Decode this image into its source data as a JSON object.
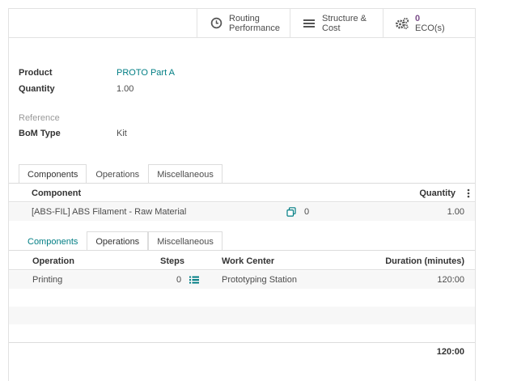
{
  "smart_buttons": {
    "routing": {
      "line1": "Routing",
      "line2": "Performance",
      "icon": "clock-icon"
    },
    "structure": {
      "line1": "Structure &",
      "line2": "Cost",
      "icon": "list-bars-icon"
    },
    "eco": {
      "count": "0",
      "label": "ECO(s)",
      "icon": "gears-icon"
    }
  },
  "fields": {
    "product": {
      "label": "Product",
      "value": "PROTO Part A"
    },
    "quantity": {
      "label": "Quantity",
      "value": "1.00"
    },
    "reference": {
      "label": "Reference",
      "value": ""
    },
    "bom_type": {
      "label": "BoM Type",
      "value": "Kit"
    }
  },
  "tabs_top": [
    "Components",
    "Operations",
    "Miscellaneous"
  ],
  "components_table": {
    "headers": {
      "component": "Component",
      "quantity": "Quantity"
    },
    "rows": [
      {
        "component": "[ABS-FIL] ABS Filament - Raw Material",
        "available": "0",
        "quantity": "1.00"
      }
    ]
  },
  "tabs_bottom": [
    "Components",
    "Operations",
    "Miscellaneous"
  ],
  "operations_table": {
    "headers": {
      "operation": "Operation",
      "steps": "Steps",
      "work_center": "Work Center",
      "duration": "Duration (minutes)"
    },
    "rows": [
      {
        "operation": "Printing",
        "steps": "0",
        "work_center": "Prototyping Station",
        "duration": "120:00"
      }
    ],
    "total_duration": "120:00"
  },
  "colors": {
    "link": "#017e84",
    "accent": "#7c4f8a",
    "border": "#dcdcdc",
    "row_bg": "#f7f7f7"
  }
}
